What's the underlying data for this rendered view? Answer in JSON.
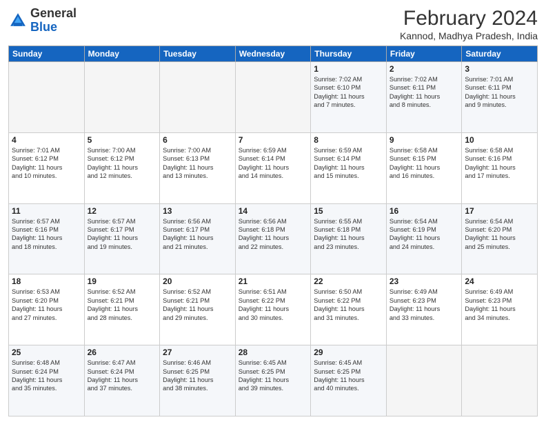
{
  "header": {
    "logo_line1": "General",
    "logo_line2": "Blue",
    "month": "February 2024",
    "location": "Kannod, Madhya Pradesh, India"
  },
  "days_of_week": [
    "Sunday",
    "Monday",
    "Tuesday",
    "Wednesday",
    "Thursday",
    "Friday",
    "Saturday"
  ],
  "weeks": [
    [
      {
        "day": "",
        "info": ""
      },
      {
        "day": "",
        "info": ""
      },
      {
        "day": "",
        "info": ""
      },
      {
        "day": "",
        "info": ""
      },
      {
        "day": "1",
        "info": "Sunrise: 7:02 AM\nSunset: 6:10 PM\nDaylight: 11 hours\nand 7 minutes."
      },
      {
        "day": "2",
        "info": "Sunrise: 7:02 AM\nSunset: 6:11 PM\nDaylight: 11 hours\nand 8 minutes."
      },
      {
        "day": "3",
        "info": "Sunrise: 7:01 AM\nSunset: 6:11 PM\nDaylight: 11 hours\nand 9 minutes."
      }
    ],
    [
      {
        "day": "4",
        "info": "Sunrise: 7:01 AM\nSunset: 6:12 PM\nDaylight: 11 hours\nand 10 minutes."
      },
      {
        "day": "5",
        "info": "Sunrise: 7:00 AM\nSunset: 6:12 PM\nDaylight: 11 hours\nand 12 minutes."
      },
      {
        "day": "6",
        "info": "Sunrise: 7:00 AM\nSunset: 6:13 PM\nDaylight: 11 hours\nand 13 minutes."
      },
      {
        "day": "7",
        "info": "Sunrise: 6:59 AM\nSunset: 6:14 PM\nDaylight: 11 hours\nand 14 minutes."
      },
      {
        "day": "8",
        "info": "Sunrise: 6:59 AM\nSunset: 6:14 PM\nDaylight: 11 hours\nand 15 minutes."
      },
      {
        "day": "9",
        "info": "Sunrise: 6:58 AM\nSunset: 6:15 PM\nDaylight: 11 hours\nand 16 minutes."
      },
      {
        "day": "10",
        "info": "Sunrise: 6:58 AM\nSunset: 6:16 PM\nDaylight: 11 hours\nand 17 minutes."
      }
    ],
    [
      {
        "day": "11",
        "info": "Sunrise: 6:57 AM\nSunset: 6:16 PM\nDaylight: 11 hours\nand 18 minutes."
      },
      {
        "day": "12",
        "info": "Sunrise: 6:57 AM\nSunset: 6:17 PM\nDaylight: 11 hours\nand 19 minutes."
      },
      {
        "day": "13",
        "info": "Sunrise: 6:56 AM\nSunset: 6:17 PM\nDaylight: 11 hours\nand 21 minutes."
      },
      {
        "day": "14",
        "info": "Sunrise: 6:56 AM\nSunset: 6:18 PM\nDaylight: 11 hours\nand 22 minutes."
      },
      {
        "day": "15",
        "info": "Sunrise: 6:55 AM\nSunset: 6:18 PM\nDaylight: 11 hours\nand 23 minutes."
      },
      {
        "day": "16",
        "info": "Sunrise: 6:54 AM\nSunset: 6:19 PM\nDaylight: 11 hours\nand 24 minutes."
      },
      {
        "day": "17",
        "info": "Sunrise: 6:54 AM\nSunset: 6:20 PM\nDaylight: 11 hours\nand 25 minutes."
      }
    ],
    [
      {
        "day": "18",
        "info": "Sunrise: 6:53 AM\nSunset: 6:20 PM\nDaylight: 11 hours\nand 27 minutes."
      },
      {
        "day": "19",
        "info": "Sunrise: 6:52 AM\nSunset: 6:21 PM\nDaylight: 11 hours\nand 28 minutes."
      },
      {
        "day": "20",
        "info": "Sunrise: 6:52 AM\nSunset: 6:21 PM\nDaylight: 11 hours\nand 29 minutes."
      },
      {
        "day": "21",
        "info": "Sunrise: 6:51 AM\nSunset: 6:22 PM\nDaylight: 11 hours\nand 30 minutes."
      },
      {
        "day": "22",
        "info": "Sunrise: 6:50 AM\nSunset: 6:22 PM\nDaylight: 11 hours\nand 31 minutes."
      },
      {
        "day": "23",
        "info": "Sunrise: 6:49 AM\nSunset: 6:23 PM\nDaylight: 11 hours\nand 33 minutes."
      },
      {
        "day": "24",
        "info": "Sunrise: 6:49 AM\nSunset: 6:23 PM\nDaylight: 11 hours\nand 34 minutes."
      }
    ],
    [
      {
        "day": "25",
        "info": "Sunrise: 6:48 AM\nSunset: 6:24 PM\nDaylight: 11 hours\nand 35 minutes."
      },
      {
        "day": "26",
        "info": "Sunrise: 6:47 AM\nSunset: 6:24 PM\nDaylight: 11 hours\nand 37 minutes."
      },
      {
        "day": "27",
        "info": "Sunrise: 6:46 AM\nSunset: 6:25 PM\nDaylight: 11 hours\nand 38 minutes."
      },
      {
        "day": "28",
        "info": "Sunrise: 6:45 AM\nSunset: 6:25 PM\nDaylight: 11 hours\nand 39 minutes."
      },
      {
        "day": "29",
        "info": "Sunrise: 6:45 AM\nSunset: 6:25 PM\nDaylight: 11 hours\nand 40 minutes."
      },
      {
        "day": "",
        "info": ""
      },
      {
        "day": "",
        "info": ""
      }
    ]
  ]
}
